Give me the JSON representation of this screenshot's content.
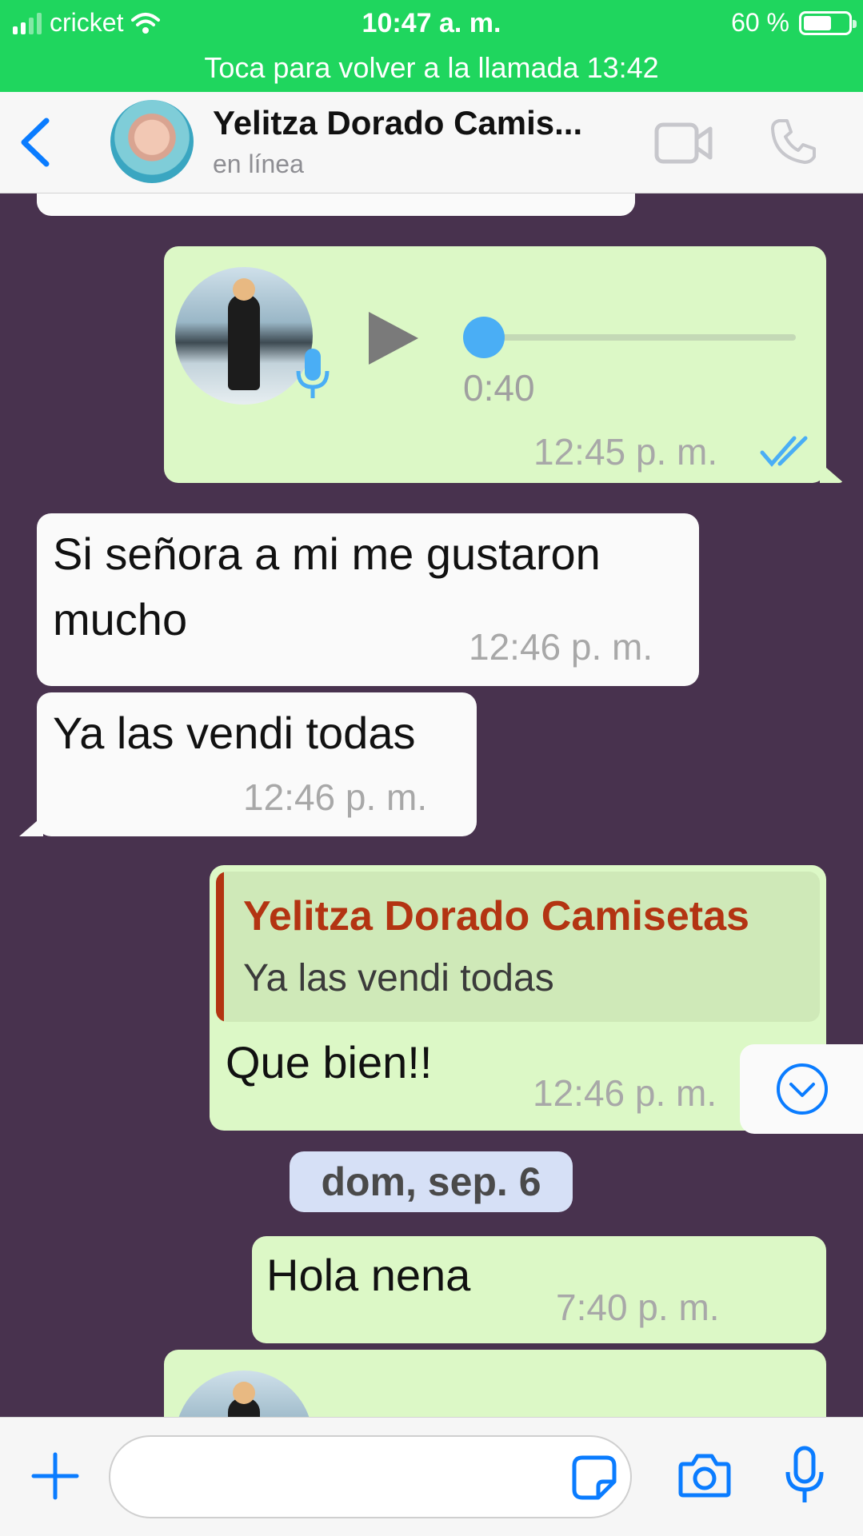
{
  "status_bar": {
    "carrier": "cricket",
    "time": "10:47 a. m.",
    "battery": "60 %",
    "battery_level": 0.6
  },
  "call_banner": {
    "text": "Toca para volver a la llamada 13:42"
  },
  "header": {
    "contact_name": "Yelitza Dorado Camis...",
    "status": "en línea",
    "video_icon": "video-camera-icon",
    "phone_icon": "phone-icon"
  },
  "messages": [
    {
      "type": "voice",
      "direction": "out",
      "duration": "0:40",
      "time": "12:45 p. m.",
      "read": true,
      "progress": 0
    },
    {
      "type": "text",
      "direction": "in",
      "lines": [
        "Si señora a mi me gustaron",
        "mucho"
      ],
      "time": "12:46 p. m."
    },
    {
      "type": "text",
      "direction": "in",
      "lines": [
        "Ya las vendi todas"
      ],
      "time": "12:46 p. m."
    },
    {
      "type": "reply",
      "direction": "out",
      "quoted_name": "Yelitza Dorado Camisetas",
      "quoted_text": "Ya las vendi todas",
      "text": "Que bien!!",
      "time": "12:46 p. m.",
      "read": true
    },
    {
      "type": "date",
      "text": "dom, sep. 6"
    },
    {
      "type": "text",
      "direction": "out",
      "lines": [
        "Hola nena"
      ],
      "time": "7:40 p. m."
    }
  ],
  "input_bar": {
    "placeholder": "",
    "plus_icon": "plus-icon",
    "sticker_icon": "sticker-icon",
    "camera_icon": "camera-icon",
    "mic_icon": "microphone-icon"
  },
  "colors": {
    "banner": "#1fd65e",
    "chat_bg": "#48324e",
    "outgoing": "#dcf8c6",
    "incoming": "#fafafa",
    "accent": "#0a7cff",
    "tick": "#4aaef5",
    "quote_name": "#b33412"
  }
}
